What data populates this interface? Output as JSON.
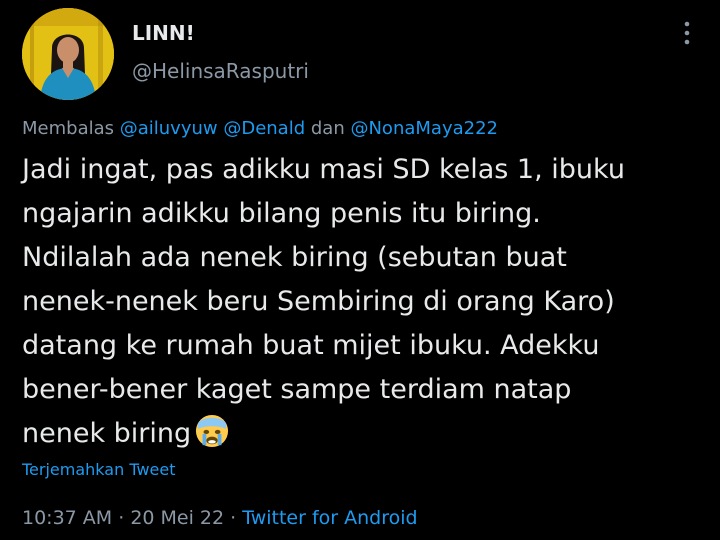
{
  "author": {
    "display_name": "LINN!",
    "handle": "@HelinsaRasputri"
  },
  "reply": {
    "prefix": "Membalas ",
    "mention_1": "@ailuvyuw",
    "mention_2": "@Denald",
    "conjunction": " dan ",
    "mention_3": "@NonaMaya222"
  },
  "tweet": {
    "text": "Jadi ingat, pas adikku masi SD kelas 1,  ibuku\nngajarin adikku bilang penis itu biring.\nNdilalah ada nenek biring (sebutan buat\nnenek-nenek beru Sembiring di orang Karo)\ndatang ke rumah buat mijet ibuku. Adekku\nbener-bener kaget sampe terdiam natap\nnenek biring",
    "emoji": "crying-face"
  },
  "translate_label": "Terjemahkan Tweet",
  "meta": {
    "time": "10:37 AM",
    "separator": " · ",
    "date": "20 Mei 22",
    "source": "Twitter for Android"
  },
  "colors": {
    "background": "#000000",
    "text": "#e7e9ea",
    "secondary": "#8b98a5",
    "accent": "#1d9bf0"
  }
}
